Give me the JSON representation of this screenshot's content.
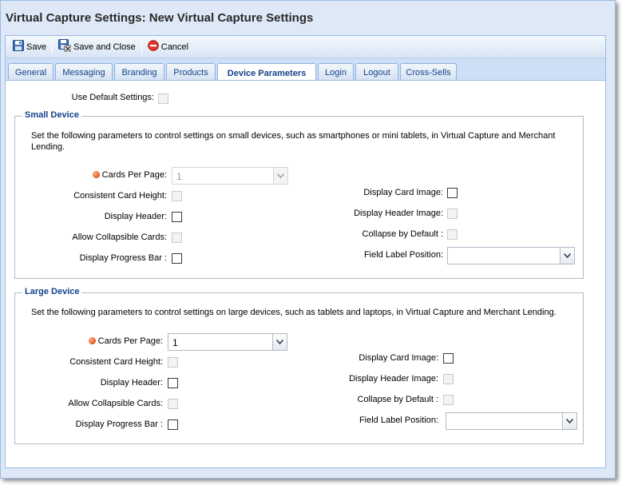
{
  "window": {
    "title": "Virtual Capture Settings: New Virtual Capture Settings"
  },
  "toolbar": {
    "save_label": "Save",
    "save_close_label": "Save and Close",
    "cancel_label": "Cancel"
  },
  "tabs": [
    {
      "label": "General"
    },
    {
      "label": "Messaging"
    },
    {
      "label": "Branding"
    },
    {
      "label": "Products"
    },
    {
      "label": "Device Parameters"
    },
    {
      "label": "Login"
    },
    {
      "label": "Logout"
    },
    {
      "label": "Cross-Sells"
    }
  ],
  "active_tab": "Device Parameters",
  "defaults": {
    "use_default_label": "Use Default Settings:"
  },
  "small": {
    "legend": "Small Device",
    "description": "Set the following parameters to control settings on small devices, such as smartphones or mini tablets, in Virtual Capture and Merchant Lending.",
    "cards_per_page_label": "Cards Per Page:",
    "cards_per_page_value": "1",
    "consistent_height_label": "Consistent Card Height:",
    "display_header_label": "Display Header:",
    "allow_collapsible_label": "Allow Collapsible Cards:",
    "display_progress_label": "Display Progress Bar :",
    "display_card_image_label": "Display Card Image:",
    "display_header_image_label": "Display Header Image:",
    "collapse_default_label": "Collapse by Default :",
    "field_label_position_label": "Field Label Position:",
    "field_label_position_value": ""
  },
  "large": {
    "legend": "Large Device",
    "description": "Set the following parameters to control settings on large devices, such as tablets and laptops, in Virtual Capture and Merchant Lending.",
    "cards_per_page_label": "Cards Per Page:",
    "cards_per_page_value": "1",
    "consistent_height_label": "Consistent Card Height:",
    "display_header_label": "Display Header:",
    "allow_collapsible_label": "Allow Collapsible Cards:",
    "display_progress_label": "Display Progress Bar :",
    "display_card_image_label": "Display Card Image:",
    "display_header_image_label": "Display Header Image:",
    "collapse_default_label": "Collapse by Default :",
    "field_label_position_label": "Field Label Position:",
    "field_label_position_value": ""
  },
  "colors": {
    "title_text": "#2a2a2a",
    "tab_text": "#15428b",
    "legend_text": "#15428b",
    "panel_border": "#99bbe8",
    "required_dot": "#e0521b"
  },
  "icons": {
    "save": "floppy-disk-icon",
    "save_close": "floppy-disk-close-icon",
    "cancel": "cancel-circle-icon",
    "combo_trigger": "chevron-down-icon",
    "required": "required-dot-icon"
  }
}
